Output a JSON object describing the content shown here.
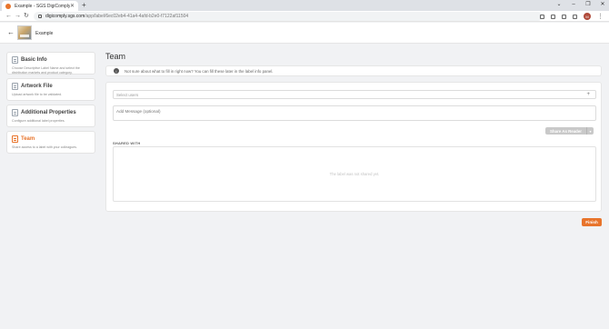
{
  "browser": {
    "tab_title": "Example - SGS DigiComply",
    "tab_close": "✕",
    "new_tab": "+",
    "url_host": "digicomply.sgs.com",
    "url_path": "/app/label/6ec02eb4-41a4-4afd-b2e0-f7122af11504",
    "profile_initial": "M",
    "window_controls": [
      "⌄",
      "–",
      "❐",
      "✕"
    ]
  },
  "header": {
    "back": "←",
    "title": "Example"
  },
  "sidebar": {
    "items": [
      {
        "title": "Basic Info",
        "desc": "Choose Descriptive Label Name and select the distribution markets and product category.",
        "active": false
      },
      {
        "title": "Artwork File",
        "desc": "Upload artwork file to be validated.",
        "active": false
      },
      {
        "title": "Additional Properties",
        "desc": "Configure additional label properties.",
        "active": false
      },
      {
        "title": "Team",
        "desc": "Share access to a label with your colleagues.",
        "active": true
      }
    ]
  },
  "main": {
    "title": "Team",
    "info_text": "Not sure about what to fill in right now? You can fill these later in the label info panel.",
    "select_placeholder": "Select users",
    "message_placeholder": "Add Message (optional)",
    "share_button": "Share As Reader",
    "share_caret": "▾",
    "shared_with_label": "SHARED WITH",
    "empty_state": "The label was not shared yet.",
    "finish_button": "Finish"
  },
  "colors": {
    "accent": "#e8742b",
    "page_bg": "#f1f2f4"
  }
}
